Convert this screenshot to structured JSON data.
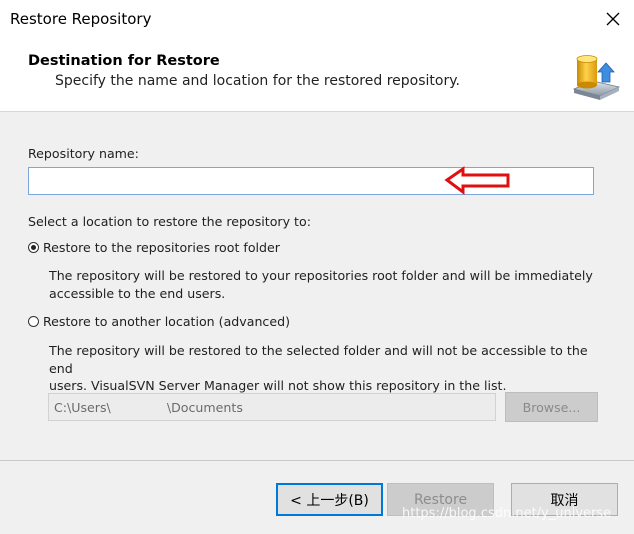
{
  "window": {
    "title": "Restore Repository"
  },
  "header": {
    "title": "Destination for Restore",
    "subtitle": "Specify the name and location for the restored repository."
  },
  "form": {
    "name_label": "Repository name:",
    "name_value": "",
    "location_prompt": "Select a location to restore the repository to:",
    "option_root": {
      "label": "Restore to the repositories root folder",
      "checked": true,
      "description_line1": "The repository will be restored to your repositories root folder and will be immediately",
      "description_line2": "accessible to the end users."
    },
    "option_other": {
      "label": "Restore to another location (advanced)",
      "checked": false,
      "description_line1": "The repository will be restored to the selected folder and will not be accessible to the end",
      "description_line2": "users. VisualSVN Server Manager will not show this repository in the list."
    },
    "path_value": "C:\\Users\\              \\Documents",
    "browse_label": "Browse..."
  },
  "footer": {
    "back_label": "< 上一步(B)",
    "restore_label": "Restore",
    "cancel_label": "取消"
  },
  "watermark": "https://blog.csdn.net/y_universe",
  "colors": {
    "accent": "#0078d7",
    "annotation_arrow": "#e01010",
    "input_focus_border": "#7ba7dd"
  },
  "icons": {
    "close": "close-icon",
    "header": "database-restore-icon",
    "annotation": "red-arrow-icon"
  }
}
